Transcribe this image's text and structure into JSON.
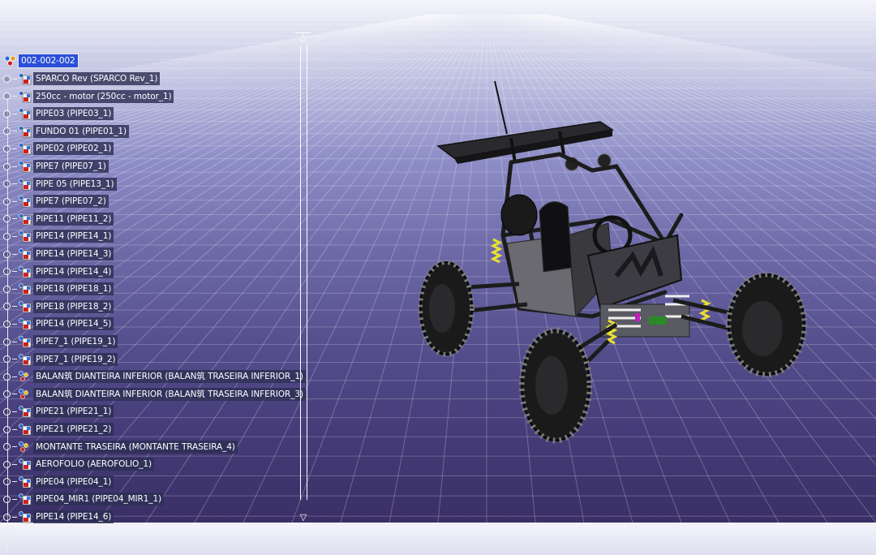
{
  "tree": {
    "root": "002-002-002",
    "items": [
      {
        "label": "SPARCO Rev (SPARCO Rev_1)",
        "icon": "part-icon"
      },
      {
        "label": "250cc - motor (250cc - motor_1)",
        "icon": "part-icon"
      },
      {
        "label": "PIPE03 (PIPE03_1)",
        "icon": "part-icon"
      },
      {
        "label": "FUNDO 01 (PIPE01_1)",
        "icon": "part-icon"
      },
      {
        "label": "PIPE02 (PIPE02_1)",
        "icon": "part-icon"
      },
      {
        "label": "PIPE7 (PIPE07_1)",
        "icon": "part-icon"
      },
      {
        "label": "PIPE 05 (PIPE13_1)",
        "icon": "part-icon"
      },
      {
        "label": "PIPE7 (PIPE07_2)",
        "icon": "part-icon"
      },
      {
        "label": "PIPE11 (PIPE11_2)",
        "icon": "part-icon"
      },
      {
        "label": "PIPE14 (PIPE14_1)",
        "icon": "part-icon"
      },
      {
        "label": "PIPE14 (PIPE14_3)",
        "icon": "part-icon"
      },
      {
        "label": "PIPE14 (PIPE14_4)",
        "icon": "part-icon"
      },
      {
        "label": "PIPE18 (PIPE18_1)",
        "icon": "part-icon"
      },
      {
        "label": "PIPE18 (PIPE18_2)",
        "icon": "part-icon"
      },
      {
        "label": "PIPE14 (PIPE14_5)",
        "icon": "part-icon"
      },
      {
        "label": "PIPE7_1 (PIPE19_1)",
        "icon": "part-icon"
      },
      {
        "label": "PIPE7_1 (PIPE19_2)",
        "icon": "part-icon"
      },
      {
        "label": "BALAN筑 DIANTEIRA INFERIOR (BALAN筑 TRASEIRA INFERIOR_1)",
        "icon": "assembly-icon"
      },
      {
        "label": "BALAN筑 DIANTEIRA INFERIOR (BALAN筑 TRASEIRA INFERIOR_3)",
        "icon": "assembly-icon"
      },
      {
        "label": "PIPE21 (PIPE21_1)",
        "icon": "part-icon"
      },
      {
        "label": "PIPE21 (PIPE21_2)",
        "icon": "part-icon"
      },
      {
        "label": "MONTANTE TRASEIRA (MONTANTE TRASEIRA_4)",
        "icon": "assembly-icon"
      },
      {
        "label": "AEROFOLIO (AEROFOLIO_1)",
        "icon": "part-icon"
      },
      {
        "label": "PIPE04 (PIPE04_1)",
        "icon": "part-icon"
      },
      {
        "label": "PIPE04_MIR1 (PIPE04_MIR1_1)",
        "icon": "part-icon"
      },
      {
        "label": "PIPE14 (PIPE14_6)",
        "icon": "part-icon"
      }
    ]
  },
  "scrollbar": {
    "up_icon": "arrow-up-icon",
    "down_icon": "arrow-down-icon"
  },
  "colors": {
    "selection": "#2a4fd8",
    "label_bg": "#2c3054",
    "frame": "#222222",
    "shock": "#e8e030"
  }
}
